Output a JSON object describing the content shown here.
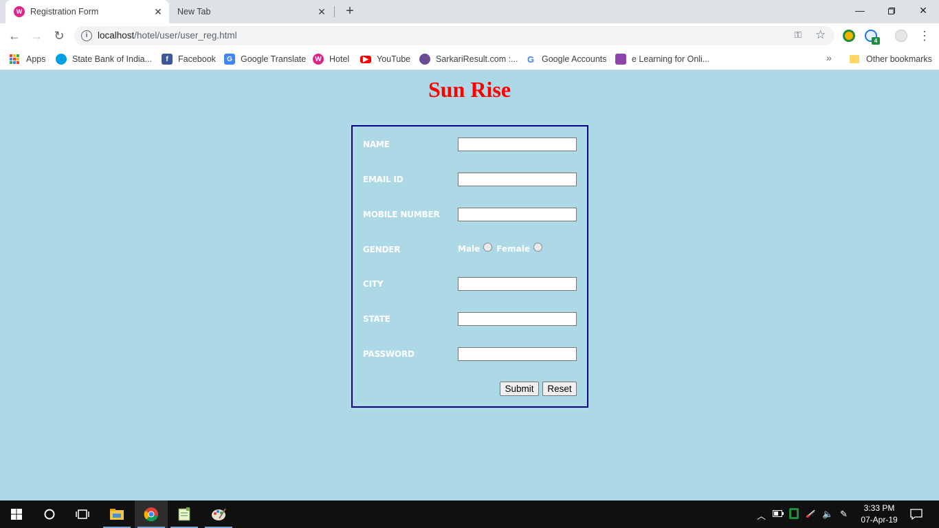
{
  "browser": {
    "tabs": [
      {
        "title": "Registration Form",
        "favicon_letter": "W",
        "active": true
      },
      {
        "title": "New Tab",
        "active": false
      }
    ],
    "url_host": "localhost",
    "url_path": "/hotel/user/user_reg.html",
    "extension_badge": "4",
    "bookmarks": [
      {
        "label": "Apps",
        "icon": "apps-grid-icon"
      },
      {
        "label": "State Bank of India...",
        "icon": "sbi-icon",
        "color": "#00a1e4"
      },
      {
        "label": "Facebook",
        "icon": "facebook-icon",
        "color": "#3b5998"
      },
      {
        "label": "Google Translate",
        "icon": "translate-icon",
        "color": "#4285f4"
      },
      {
        "label": "Hotel",
        "icon": "hotel-icon",
        "color": "#e0218a"
      },
      {
        "label": "YouTube",
        "icon": "youtube-icon",
        "color": "#ff0000"
      },
      {
        "label": "SarkariResult.com :...",
        "icon": "sarkari-icon",
        "color": "#6a4c93"
      },
      {
        "label": "Google Accounts",
        "icon": "google-icon",
        "color": "#4285f4"
      },
      {
        "label": "e Learning for Onli...",
        "icon": "elearning-icon",
        "color": "#8e44ad"
      }
    ],
    "other_bookmarks": "Other bookmarks"
  },
  "page": {
    "heading": "Sun Rise",
    "heading_color": "#ff0000",
    "background": "#add8e6",
    "form": {
      "fields": [
        {
          "label": "NAME",
          "type": "text",
          "value": ""
        },
        {
          "label": "EMAIL ID",
          "type": "text",
          "value": ""
        },
        {
          "label": "MOBILE NUMBER",
          "type": "text",
          "value": ""
        },
        {
          "label": "GENDER",
          "type": "radio"
        },
        {
          "label": "CITY",
          "type": "text",
          "value": ""
        },
        {
          "label": "STATE",
          "type": "text",
          "value": ""
        },
        {
          "label": "PASSWORD",
          "type": "password",
          "value": ""
        }
      ],
      "gender_options": [
        "Male",
        "Female"
      ],
      "submit_label": "Submit",
      "reset_label": "Reset"
    }
  },
  "taskbar": {
    "time": "3:33 PM",
    "date": "07-Apr-19"
  }
}
